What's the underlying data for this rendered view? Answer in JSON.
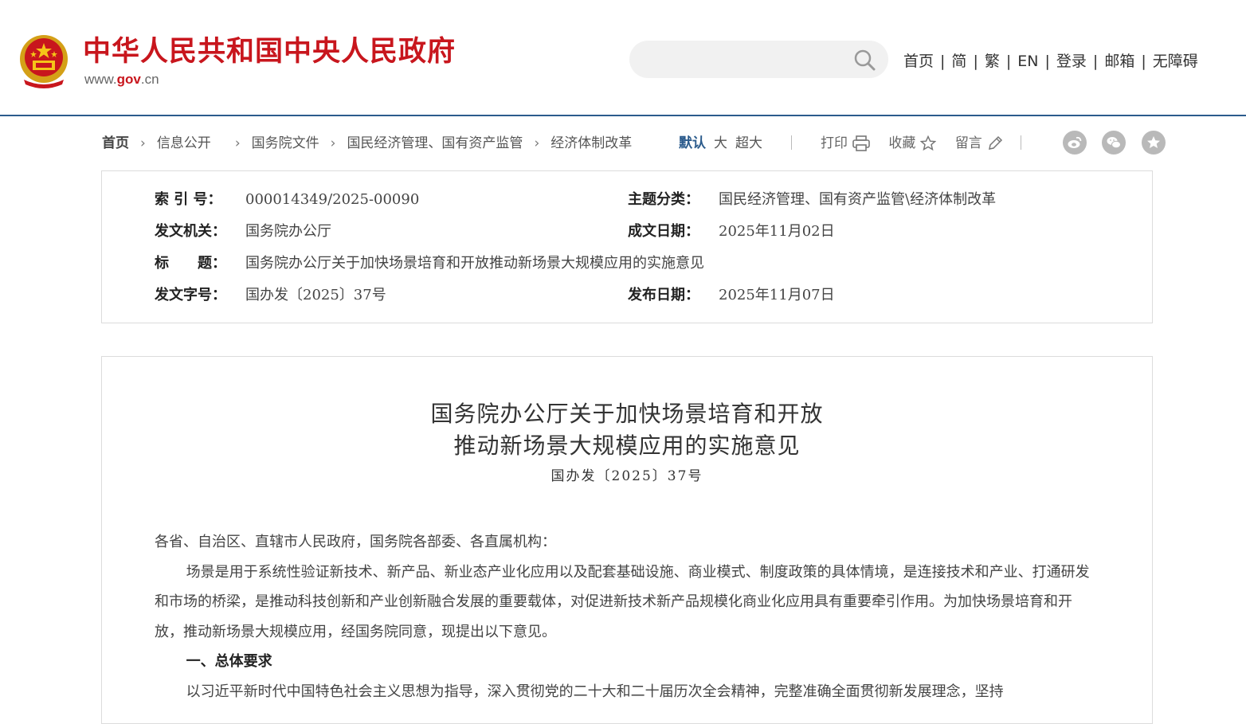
{
  "header": {
    "site_title": "中华人民共和国中央人民政府",
    "domain_prefix": "www.",
    "domain_mid": "gov",
    "domain_suffix": ".cn",
    "search_placeholder": "",
    "nav": [
      "首页",
      "简",
      "繁",
      "EN",
      "登录",
      "邮箱",
      "无障碍"
    ]
  },
  "breadcrumb": [
    "首页",
    "信息公开",
    "国务院文件",
    "国民经济管理、国有资产监管",
    "经济体制改革"
  ],
  "font_size": {
    "options": [
      "默认",
      "大",
      "超大"
    ],
    "active": "默认"
  },
  "tools": {
    "print": "打印",
    "favorite": "收藏",
    "comment": "留言"
  },
  "share": [
    "weibo-icon",
    "wechat-icon",
    "favorite-share-icon"
  ],
  "info": {
    "index_label": "索 引 号：",
    "index_value": "000014349/2025-00090",
    "topic_label": "主题分类：",
    "topic_value": "国民经济管理、国有资产监管\\经济体制改革",
    "issuer_label": "发文机关：",
    "issuer_value": "国务院办公厅",
    "written_label": "成文日期：",
    "written_value": "2025年11月02日",
    "title_label": "标　　题：",
    "title_value": "国务院办公厅关于加快场景培育和开放推动新场景大规模应用的实施意见",
    "docno_label": "发文字号：",
    "docno_value": "国办发〔2025〕37号",
    "published_label": "发布日期：",
    "published_value": "2025年11月07日"
  },
  "article": {
    "title_line1": "国务院办公厅关于加快场景培育和开放",
    "title_line2": "推动新场景大规模应用的实施意见",
    "doc_number": "国办发〔2025〕37号",
    "salutation": "各省、自治区、直辖市人民政府，国务院各部委、各直属机构：",
    "paragraph1": "场景是用于系统性验证新技术、新产品、新业态产业化应用以及配套基础设施、商业模式、制度政策的具体情境，是连接技术和产业、打通研发和市场的桥梁，是推动科技创新和产业创新融合发展的重要载体，对促进新技术新产品规模化商业化应用具有重要牵引作用。为加快场景培育和开放，推动新场景大规模应用，经国务院同意，现提出以下意见。",
    "section1": "一、总体要求",
    "paragraph2": "以习近平新时代中国特色社会主义思想为指导，深入贯彻党的二十大和二十届历次全会精神，完整准确全面贯彻新发展理念，坚持"
  },
  "colors": {
    "brand_red": "#c8161d",
    "accent_blue": "#2b5b8c",
    "border": "#dcdcdc"
  }
}
